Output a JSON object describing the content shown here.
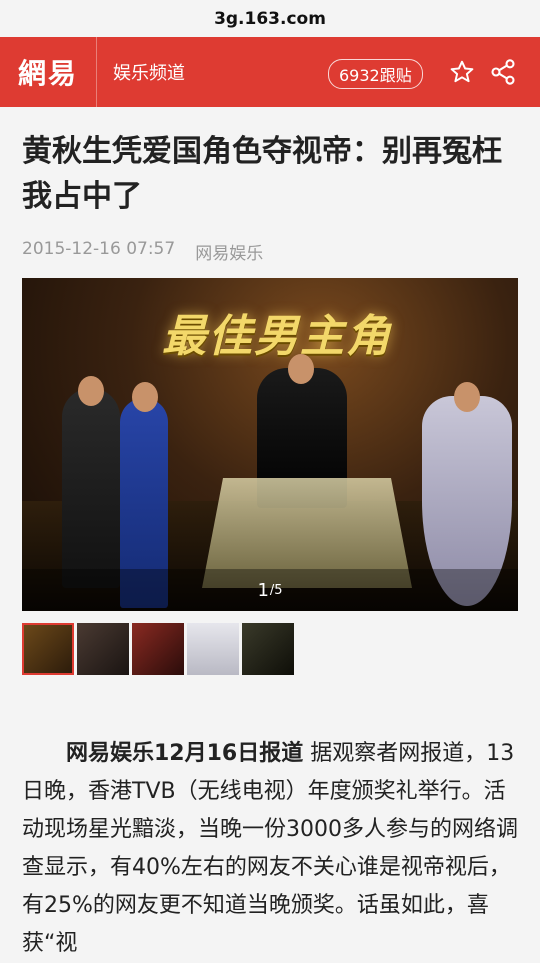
{
  "browser": {
    "url": "3g.163.com"
  },
  "header": {
    "logo": "網易",
    "channel": "娱乐频道",
    "comments": "6932跟贴",
    "star_icon": "star-icon",
    "share_icon": "share-icon",
    "accent": "#de3b32"
  },
  "article": {
    "title": "黄秋生凭爱国角色夺视帝：别再冤枉我占中了",
    "date": "2015-12-16 07:57",
    "source": "网易娱乐",
    "gallery": {
      "banner": "最佳男主角",
      "current": "1",
      "total": "/5",
      "thumb_count": 5
    },
    "body_lead": "网易娱乐12月16日报道",
    "body_text": " 据观察者网报道，13日晚，香港TVB（无线电视）年度颁奖礼举行。活动现场星光黯淡，当晚一份3000多人参与的网络调查显示，有40%左右的网友不关心谁是视帝视后，有25%的网友更不知道当晚颁奖。话虽如此，喜获“视"
  }
}
